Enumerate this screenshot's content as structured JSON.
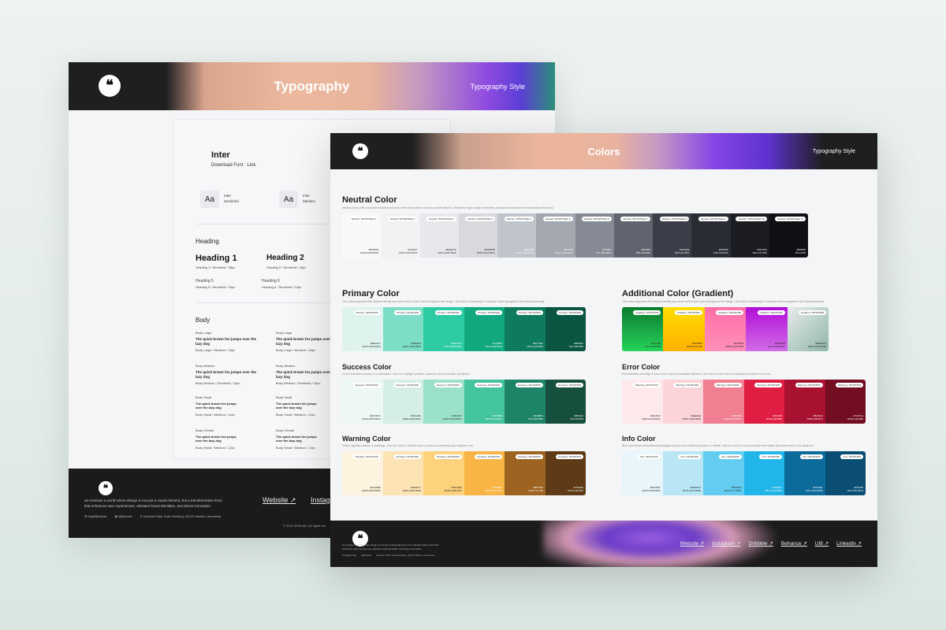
{
  "typography_sheet": {
    "title": "Typography",
    "subtitle": "Typography Style",
    "font": {
      "name": "Inter",
      "link": "Download Font : Link"
    },
    "weights": [
      {
        "glyph": "Aa",
        "name": "Inter",
        "weight": "Semibold"
      },
      {
        "glyph": "Aa",
        "name": "Inter",
        "weight": "Medium"
      }
    ],
    "heading_section": "Heading",
    "headings": [
      {
        "label": "Heading 1",
        "spec": "Heading 1 / Semibold / 48px"
      },
      {
        "label": "Heading 2",
        "spec": "Heading 2 / Semibold / 40px"
      },
      {
        "label": "Heading 5",
        "spec": "Heading 5 / Semibold / 16px"
      },
      {
        "label": "Heading 6",
        "spec": "Heading 6 / Semibold / 14px"
      }
    ],
    "body_section": "Body",
    "sample": "The quick brown fox jumps over the lazy dog",
    "body_styles": [
      {
        "label": "Body Large",
        "spec": "Body Large / Medium / 18px"
      },
      {
        "label": "Body Large",
        "spec": "Body Large / Medium / 18px"
      },
      {
        "label": "Body Medium",
        "spec": "Body Medium / Semibold / 16px"
      },
      {
        "label": "Body Medium",
        "spec": "Body Medium / Semibold / 16px"
      },
      {
        "label": "Body Small",
        "spec": "Body Small / Medium / 14px"
      },
      {
        "label": "Body Small",
        "spec": "Body Small / Medium / 14px"
      },
      {
        "label": "Body XSmall",
        "spec": "Body Small / Medium / 12px"
      },
      {
        "label": "Body XSmall",
        "spec": "Body Small / Medium / 12px"
      }
    ],
    "footer": {
      "about": "we envision a world where design is not just a visual element, but a transformative force that enhances user experiences, elevates brand identities, and drives innovation.",
      "email": "hey@jkstudio",
      "handle": "@jkstudio",
      "address": "Kalcemi Kidul, Kota Gending, 42119, Banten, Indonesia",
      "links": [
        "Website",
        "Instag"
      ],
      "copyright": "© 2024 JKStudio. All rights res"
    }
  },
  "colors_sheet": {
    "title": "Colors",
    "subtitle": "Typography Style",
    "groups": {
      "neutral": {
        "title": "Neutral Color",
        "desc": "Neutral colors offer a neutral backdrop that lets other colors stand out and provide balance. Select the right shade to maintain contrast and enhance the information hierarchy.",
        "swatches": [
          {
            "name": "Neutral / SP/GP/State 0",
            "color": "#f7f8fa",
            "hex": "#F9FAFB",
            "rgb": "R249 G250 B251"
          },
          {
            "name": "Neutral / SP/GP/State 1",
            "color": "#f1f2f4",
            "hex": "#F2F4F7",
            "rgb": "R242 G244 B247"
          },
          {
            "name": "Neutral / SP/GP/State 2",
            "color": "#e6e8ec",
            "hex": "#EAECF0",
            "rgb": "R234 G236 B240"
          },
          {
            "name": "Neutral / SP/GP/State 3",
            "color": "#d7d9de",
            "hex": "#D0D5DD",
            "rgb": "R208 G213 B221"
          },
          {
            "name": "Neutral / SP/GP/State 4",
            "color": "#c0c4cb",
            "hex": "#98A2B3",
            "rgb": "R152 G162 B179"
          },
          {
            "name": "Neutral / SP/GP/State 5",
            "color": "#a2a7b0",
            "hex": "#667085",
            "rgb": "R102 G112 B133"
          },
          {
            "name": "Neutral / SP/GP/State 6",
            "color": "#868a94",
            "hex": "#475467",
            "rgb": "R71 G84 B103"
          },
          {
            "name": "Neutral / SP/GP/State 7",
            "color": "#60646e",
            "hex": "#344054",
            "rgb": "R52 G64 B84"
          },
          {
            "name": "Neutral / SP/GP/State 8",
            "color": "#3b3e48",
            "hex": "#1D2939",
            "rgb": "R29 G41 B57"
          },
          {
            "name": "Neutral / SP/GP/State 9",
            "color": "#2a2c34",
            "hex": "#101828",
            "rgb": "R16 G24 B40"
          },
          {
            "name": "Neutral / SP/GP/State 10",
            "color": "#1c1d23",
            "hex": "#0C111D",
            "rgb": "R12 G17 B29"
          },
          {
            "name": "Neutral / SP/GP/State 11",
            "color": "#0f1014",
            "hex": "#000000",
            "rgb": "R0 G0 B0"
          }
        ]
      },
      "primary": {
        "title": "Primary Color",
        "desc": "The colors represent the brand's identity and serve as the main color throughout the design. Use them consistently to reinforce brand recognition and visual continuity.",
        "swatches": [
          {
            "name": "Primary / SP/GP/100",
            "color": "#def3ee",
            "hex": "#E6FAF4",
            "rgb": "R230 G250 B244"
          },
          {
            "name": "Primary / SP/GP/200",
            "color": "#7dddc6",
            "hex": "#7DE0C8",
            "rgb": "R125 G224 B200"
          },
          {
            "name": "Primary / SP/GP/300",
            "color": "#2ccba4",
            "hex": "#2ECDA6",
            "rgb": "R46 G205 B166"
          },
          {
            "name": "Primary / SP/GP/400",
            "color": "#12a981",
            "hex": "#14A882",
            "rgb": "R20 G168 B130"
          },
          {
            "name": "Primary / SP/GP/500",
            "color": "#0e7a5e",
            "hex": "#0F7A5E",
            "rgb": "R15 G122 B94"
          },
          {
            "name": "Primary / SP/GP/600",
            "color": "#0b5642",
            "hex": "#0B5642",
            "rgb": "R11 G86 B66"
          }
        ]
      },
      "gradient": {
        "title": "Additional Color (Gradient)",
        "desc": "The colors represent the brand's identity and serve as the main color throughout the design. Use them consistently to enhance brand recognition and visual continuity.",
        "swatches": [
          {
            "name": "Gradient / SP/GP/100",
            "color": "linear-gradient(180deg,#0a7a2e,#27d35a)",
            "hex": "#0A7A2E",
            "rgb": "R10 G122 B46"
          },
          {
            "name": "Gradient / SP/GP/200",
            "color": "linear-gradient(180deg,#ffdd00,#ffb000)",
            "hex": "#FFD500",
            "rgb": "R255 G213 B0"
          },
          {
            "name": "Gradient / SP/GP/300",
            "color": "linear-gradient(180deg,#ff6fa8,#ff8fb8)",
            "hex": "#FF6FA8",
            "rgb": "R255 G111 B168"
          },
          {
            "name": "Gradient / SP/GP/400",
            "color": "linear-gradient(180deg,#b10fd8,#d26ce6)",
            "hex": "#B10FD8",
            "rgb": "R177 G15 B216"
          },
          {
            "name": "Gradient / SP/GP/500",
            "color": "linear-gradient(135deg,#e8ecec,#8fb5a9)",
            "hex": "#E8ECEC",
            "rgb": "R232 G236 B236"
          }
        ]
      },
      "success": {
        "title": "Success Color",
        "desc": "Green indicates success or confirmation. Use it to highlight positive outcomes and successful operations.",
        "swatches": [
          {
            "name": "Success / SP/GP/100",
            "color": "#edf8f4",
            "hex": "#ECFDF3",
            "rgb": "R236 G253 B243"
          },
          {
            "name": "Success / SP/GP/200",
            "color": "#d5efe6",
            "hex": "#D1FADF",
            "rgb": "R209 G250 B223"
          },
          {
            "name": "Success / SP/GP/300",
            "color": "#9be0cb",
            "hex": "#A6F4C5",
            "rgb": "R166 G244 B197"
          },
          {
            "name": "Success / SP/GP/400",
            "color": "#44c49c",
            "hex": "#32D583",
            "rgb": "R50 G213 B131"
          },
          {
            "name": "Success / SP/GP/500",
            "color": "#1e8467",
            "hex": "#039855",
            "rgb": "R3 G152 B85"
          },
          {
            "name": "Success / SP/GP/600",
            "color": "#174f3e",
            "hex": "#054F31",
            "rgb": "R5 G79 B49"
          }
        ]
      },
      "error": {
        "title": "Error Color",
        "desc": "Red indicates warnings or errors that require immediate attention. Use them to alert users to important problems or errors.",
        "swatches": [
          {
            "name": "Warning / SP/GP/100",
            "color": "#fde9ec",
            "hex": "#FEF3F2",
            "rgb": "R254 G243 B242"
          },
          {
            "name": "Warning / SP/GP/200",
            "color": "#fbd4da",
            "hex": "#FEE4E2",
            "rgb": "R254 G228 B226"
          },
          {
            "name": "Warning / SP/GP/300",
            "color": "#ef7f91",
            "hex": "#F97066",
            "rgb": "R249 G112 B102"
          },
          {
            "name": "Warning / SP/GP/400",
            "color": "#e01e44",
            "hex": "#F04438",
            "rgb": "R240 G68 B56"
          },
          {
            "name": "Warning / SP/GP/500",
            "color": "#a8112f",
            "hex": "#B42318",
            "rgb": "R180 G35 B24"
          },
          {
            "name": "Warning / SP/GP/600",
            "color": "#720d22",
            "hex": "#7A271A",
            "rgb": "R122 G39 B26"
          }
        ]
      },
      "warning": {
        "title": "Warning Color",
        "desc": "Yellow signifies caution or warnings. Use this color to indicate that a process is underway and requires care.",
        "swatches": [
          {
            "name": "Pending / SP/GP/100",
            "color": "#fdf3de",
            "hex": "#FFFAEB",
            "rgb": "R255 G250 B235"
          },
          {
            "name": "Pending / SP/GP/200",
            "color": "#fbe3b4",
            "hex": "#FEF0C7",
            "rgb": "R254 G240 B199"
          },
          {
            "name": "Pending / SP/GP/300",
            "color": "#fdd27c",
            "hex": "#FEC84B",
            "rgb": "R254 G200 B75"
          },
          {
            "name": "Pending / SP/GP/400",
            "color": "#f8b444",
            "hex": "#FDB022",
            "rgb": "R253 G176 B34"
          },
          {
            "name": "Pending / SP/GP/500",
            "color": "#9c6420",
            "hex": "#B54708",
            "rgb": "R181 G71 B8"
          },
          {
            "name": "Pending / SP/GP/600",
            "color": "#5e3a16",
            "hex": "#7A2E0E",
            "rgb": "R122 G46 B14"
          }
        ]
      },
      "info": {
        "title": "Info Color",
        "desc": "Blue represents informational messages that provide additional context or details. Use this color to convey neutral information that users need to be aware of.",
        "swatches": [
          {
            "name": "Info / SP/GP/100",
            "color": "#e8f6fb",
            "hex": "#EFF8FF",
            "rgb": "R239 G248 B255"
          },
          {
            "name": "Info / SP/GP/200",
            "color": "#b9e6f5",
            "hex": "#B2DDFF",
            "rgb": "R178 G221 B255"
          },
          {
            "name": "Info / SP/GP/300",
            "color": "#62cdf0",
            "hex": "#53B1FD",
            "rgb": "R83 G177 B253"
          },
          {
            "name": "Info / SP/GP/400",
            "color": "#22b5ea",
            "hex": "#2E90FA",
            "rgb": "R46 G144 B250"
          },
          {
            "name": "Info / SP/GP/500",
            "color": "#0d6b9c",
            "hex": "#1570EF",
            "rgb": "R21 G112 B239"
          },
          {
            "name": "Info / SP/GP/600",
            "color": "#0b4e74",
            "hex": "#194185",
            "rgb": "R25 G65 B133"
          }
        ]
      }
    },
    "footer": {
      "about": "we envision a world where design is not just a visual element, but a transformative force that enhances user experiences, elevates brand identities, and drives innovation.",
      "email": "hey@jkstudio",
      "handle": "@jkstudio",
      "address": "Kalcemi Kidul, Kota Gending, 42119, Banten, Indonesia",
      "links": [
        "Website ↗",
        "Instagram ↗",
        "Dribbble ↗",
        "Behance ↗",
        "UI8 ↗",
        "LinkedIn ↗"
      ],
      "copyright": "© 2024 JKStudio. All rights reserved"
    }
  }
}
